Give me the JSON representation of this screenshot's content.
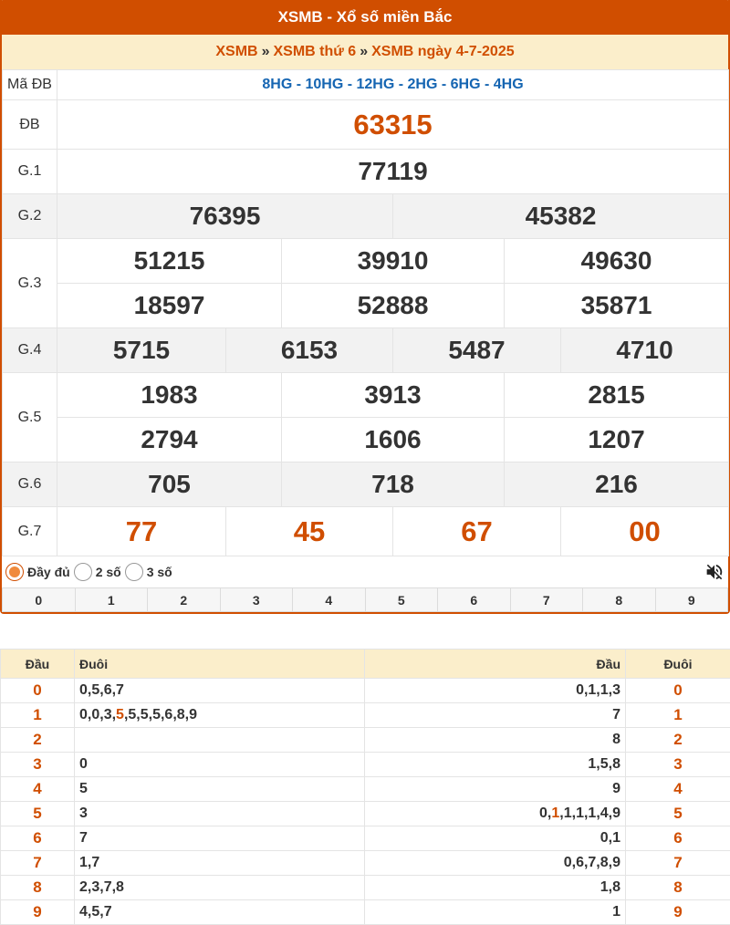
{
  "header": {
    "title": "XSMB - Xổ số miền Bắc"
  },
  "breadcrumb": {
    "items": [
      "XSMB",
      "XSMB thứ 6",
      "XSMB ngày 4-7-2025"
    ],
    "separator": "»"
  },
  "results": {
    "ma_db_label": "Mã ĐB",
    "ma_db_value": "8HG - 10HG - 12HG - 2HG - 6HG - 4HG",
    "db_label": "ĐB",
    "db": "63315",
    "g1_label": "G.1",
    "g1": [
      "77119"
    ],
    "g2_label": "G.2",
    "g2": [
      "76395",
      "45382"
    ],
    "g3_label": "G.3",
    "g3": [
      "51215",
      "39910",
      "49630",
      "18597",
      "52888",
      "35871"
    ],
    "g4_label": "G.4",
    "g4": [
      "5715",
      "6153",
      "5487",
      "4710"
    ],
    "g5_label": "G.5",
    "g5": [
      "1983",
      "3913",
      "2815",
      "2794",
      "1606",
      "1207"
    ],
    "g6_label": "G.6",
    "g6": [
      "705",
      "718",
      "216"
    ],
    "g7_label": "G.7",
    "g7": [
      "77",
      "45",
      "67",
      "00"
    ]
  },
  "options": {
    "full": "Đầy đủ",
    "two": "2 số",
    "three": "3 số",
    "selected": "full",
    "mute_icon": "volume-mute-icon"
  },
  "digits": [
    "0",
    "1",
    "2",
    "3",
    "4",
    "5",
    "6",
    "7",
    "8",
    "9"
  ],
  "loto": {
    "headers": {
      "dau": "Đầu",
      "duoi": "Đuôi",
      "dau2": "Đầu",
      "duoi2": "Đuôi"
    },
    "rows": [
      {
        "head": "0",
        "tails_pre": "0,5,6,7",
        "tails_hl": "",
        "tails_post": "",
        "heads_pre": "0,1,1,3",
        "heads_hl": "",
        "heads_post": "",
        "tail": "0"
      },
      {
        "head": "1",
        "tails_pre": "0,0,3,",
        "tails_hl": "5",
        "tails_post": ",5,5,5,6,8,9",
        "heads_pre": "7",
        "heads_hl": "",
        "heads_post": "",
        "tail": "1"
      },
      {
        "head": "2",
        "tails_pre": "",
        "tails_hl": "",
        "tails_post": "",
        "heads_pre": "8",
        "heads_hl": "",
        "heads_post": "",
        "tail": "2"
      },
      {
        "head": "3",
        "tails_pre": "0",
        "tails_hl": "",
        "tails_post": "",
        "heads_pre": "1,5,8",
        "heads_hl": "",
        "heads_post": "",
        "tail": "3"
      },
      {
        "head": "4",
        "tails_pre": "5",
        "tails_hl": "",
        "tails_post": "",
        "heads_pre": "9",
        "heads_hl": "",
        "heads_post": "",
        "tail": "4"
      },
      {
        "head": "5",
        "tails_pre": "3",
        "tails_hl": "",
        "tails_post": "",
        "heads_pre": "0,",
        "heads_hl": "1",
        "heads_post": ",1,1,1,4,9",
        "tail": "5"
      },
      {
        "head": "6",
        "tails_pre": "7",
        "tails_hl": "",
        "tails_post": "",
        "heads_pre": "0,1",
        "heads_hl": "",
        "heads_post": "",
        "tail": "6"
      },
      {
        "head": "7",
        "tails_pre": "1,7",
        "tails_hl": "",
        "tails_post": "",
        "heads_pre": "0,6,7,8,9",
        "heads_hl": "",
        "heads_post": "",
        "tail": "7"
      },
      {
        "head": "8",
        "tails_pre": "2,3,7,8",
        "tails_hl": "",
        "tails_post": "",
        "heads_pre": "1,8",
        "heads_hl": "",
        "heads_post": "",
        "tail": "8"
      },
      {
        "head": "9",
        "tails_pre": "4,5,7",
        "tails_hl": "",
        "tails_post": "",
        "heads_pre": "1",
        "heads_hl": "",
        "heads_post": "",
        "tail": "9"
      }
    ]
  }
}
